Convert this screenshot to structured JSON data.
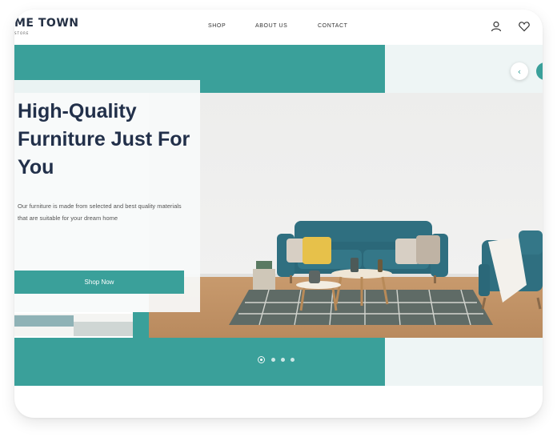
{
  "brand": {
    "name": "ME TOWN",
    "tagline": "STORE"
  },
  "nav": {
    "links": [
      "SHOP",
      "ABOUT US",
      "CONTACT"
    ],
    "icons": [
      "user-icon",
      "heart-icon"
    ]
  },
  "hero": {
    "title": "High-Quality Furniture Just For You",
    "description": "Our furniture is made from selected and best quality materials that are suitable for your dream home",
    "cta_label": "Shop Now"
  },
  "carousel": {
    "slide_count": 4,
    "active_index": 0,
    "prev_icon": "chevron-left-icon",
    "prev_glyph": "‹"
  },
  "colors": {
    "accent": "#3aa09a",
    "pale": "#eef5f5",
    "heading": "#22304a",
    "sofa": "#2f6f80",
    "floor": "#c89a6d"
  }
}
